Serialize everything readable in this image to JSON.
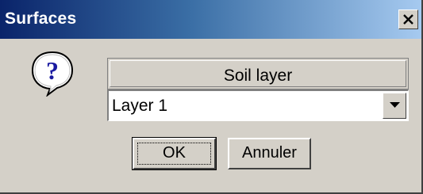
{
  "window": {
    "title": "Surfaces",
    "close_symbol": "×"
  },
  "dialog": {
    "icon": "question-icon",
    "header_label": "Soil layer",
    "select": {
      "selected": "Layer 1"
    },
    "buttons": {
      "ok_label": "OK",
      "cancel_label": "Annuler"
    }
  },
  "colors": {
    "title_gradient_start": "#0a246a",
    "title_gradient_end": "#a6caf0",
    "face": "#d4d0c8",
    "icon_blue": "#1a1aa0"
  }
}
